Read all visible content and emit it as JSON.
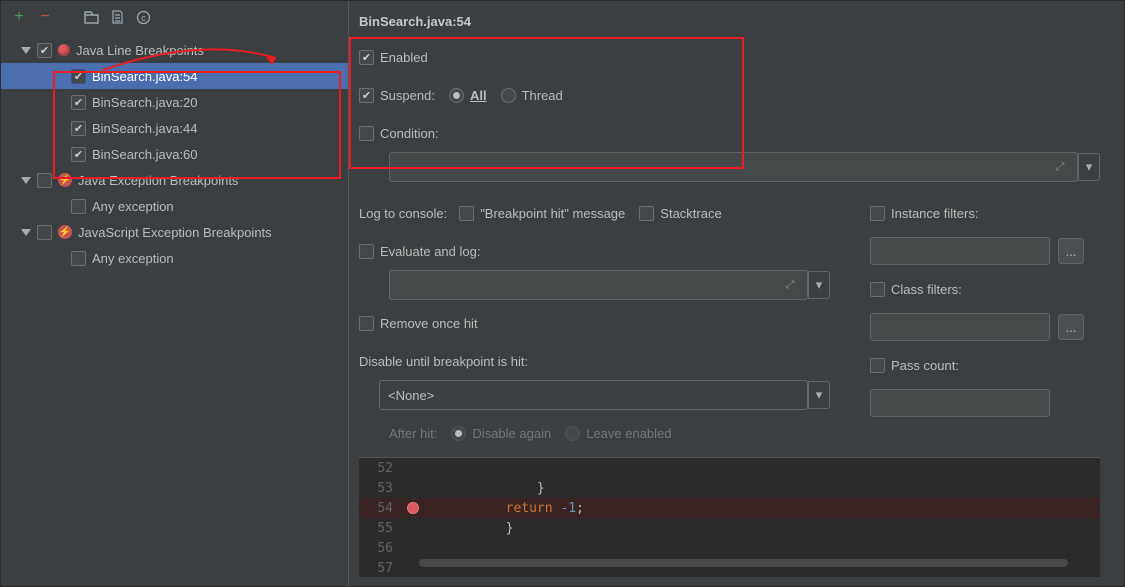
{
  "title": "BinSearch.java:54",
  "tree": {
    "group1": {
      "label": "Java Line Breakpoints",
      "items": [
        {
          "label": "BinSearch.java:54",
          "selected": true
        },
        {
          "label": "BinSearch.java:20"
        },
        {
          "label": "BinSearch.java:44"
        },
        {
          "label": "BinSearch.java:60"
        }
      ]
    },
    "group2": {
      "label": "Java Exception Breakpoints",
      "items": [
        {
          "label": "Any exception"
        }
      ]
    },
    "group3": {
      "label": "JavaScript Exception Breakpoints",
      "items": [
        {
          "label": "Any exception"
        }
      ]
    }
  },
  "enabled_label": "Enabled",
  "suspend_label": "Suspend:",
  "suspend_all": "All",
  "suspend_thread": "Thread",
  "condition_label": "Condition:",
  "log_to_console": "Log to console:",
  "bp_hit": "\"Breakpoint hit\" message",
  "stacktrace": "Stacktrace",
  "eval_log": "Evaluate and log:",
  "remove_once": "Remove once hit",
  "disable_until": "Disable until breakpoint is hit:",
  "none_label": "<None>",
  "after_hit": "After hit:",
  "disable_again": "Disable again",
  "leave_enabled": "Leave enabled",
  "instance_filters": "Instance filters:",
  "class_filters": "Class filters:",
  "pass_count": "Pass count:",
  "dots": "...",
  "code": {
    "l52": "52",
    "l53": "53",
    "l54": "54",
    "l55": "55",
    "l56": "56",
    "l57": "57",
    "t53": "            }",
    "t54a": "return",
    "t54b": " -1",
    "t54c": ";",
    "t55": "        }"
  }
}
